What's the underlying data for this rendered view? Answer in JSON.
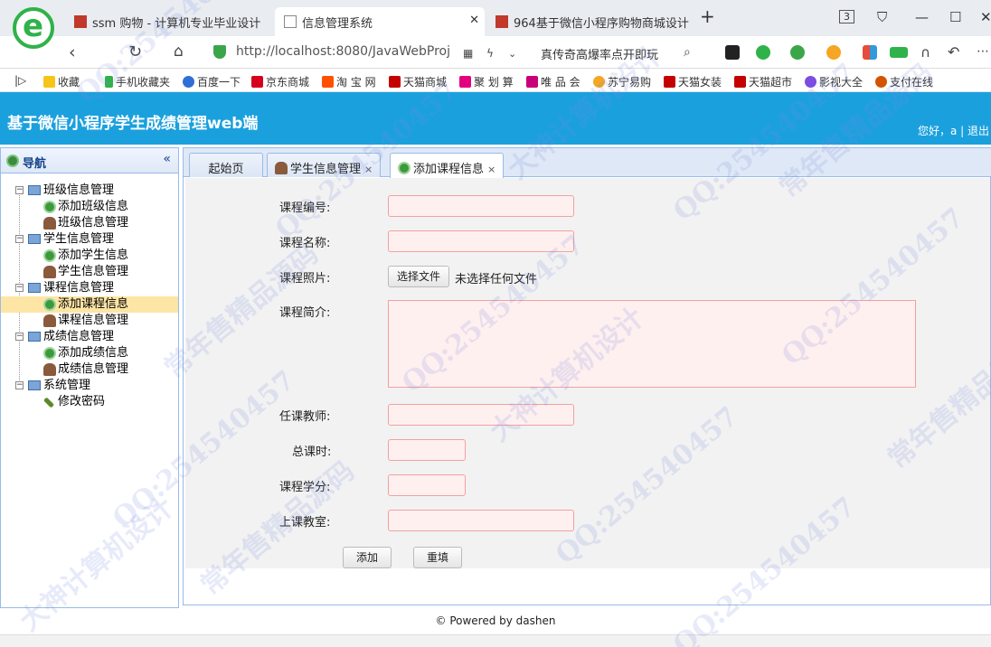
{
  "browser": {
    "tabs": [
      {
        "label": "ssm 购物 - 计算机专业毕业设计"
      },
      {
        "label": "信息管理系统"
      },
      {
        "label": "964基于微信小程序购物商城设计"
      }
    ],
    "tab_count": "3",
    "url": "http://localhost:8080/JavaWebProj",
    "search_hint": "真传奇高爆率点开即玩"
  },
  "bookmarks": [
    "收藏",
    "手机收藏夹",
    "百度一下",
    "京东商城",
    "淘 宝 网",
    "天猫商城",
    "聚 划 算",
    "唯 品 会",
    "苏宁易购",
    "天猫女装",
    "天猫超市",
    "影视大全",
    "支付在线"
  ],
  "app": {
    "title": "基于微信小程序学生成绩管理web端",
    "greeting": "您好，a | 退出"
  },
  "nav": {
    "title": "导航",
    "collapse": "«",
    "groups": [
      {
        "label": "班级信息管理",
        "items": [
          {
            "label": "添加班级信息",
            "icon": "add-icon"
          },
          {
            "label": "班级信息管理",
            "icon": "user-icon"
          }
        ]
      },
      {
        "label": "学生信息管理",
        "items": [
          {
            "label": "添加学生信息",
            "icon": "add-icon"
          },
          {
            "label": "学生信息管理",
            "icon": "user-icon"
          }
        ]
      },
      {
        "label": "课程信息管理",
        "items": [
          {
            "label": "添加课程信息",
            "icon": "add-icon",
            "selected": true
          },
          {
            "label": "课程信息管理",
            "icon": "user-icon"
          }
        ]
      },
      {
        "label": "成绩信息管理",
        "items": [
          {
            "label": "添加成绩信息",
            "icon": "add-icon"
          },
          {
            "label": "成绩信息管理",
            "icon": "user-icon"
          }
        ]
      },
      {
        "label": "系统管理",
        "items": [
          {
            "label": "修改密码",
            "icon": "pencil-icon"
          }
        ]
      }
    ]
  },
  "content_tabs": [
    {
      "label": "起始页"
    },
    {
      "label": "学生信息管理",
      "close": "×"
    },
    {
      "label": "添加课程信息",
      "close": "×",
      "active": true
    }
  ],
  "form": {
    "course_no": {
      "label": "课程编号:",
      "value": ""
    },
    "course_name": {
      "label": "课程名称:",
      "value": ""
    },
    "course_photo": {
      "label": "课程照片:",
      "button": "选择文件",
      "status": "未选择任何文件"
    },
    "course_intro": {
      "label": "课程简介:",
      "value": ""
    },
    "teacher": {
      "label": "任课教师:",
      "value": ""
    },
    "total_hours": {
      "label": "总课时:",
      "value": ""
    },
    "credits": {
      "label": "课程学分:",
      "value": ""
    },
    "classroom": {
      "label": "上课教室:",
      "value": ""
    },
    "submit": "添加",
    "reset": "重填"
  },
  "footer": "© Powered by dashen",
  "watermarks": [
    "QQ:254540457",
    "常年售精品源码",
    "大神计算机设计"
  ]
}
